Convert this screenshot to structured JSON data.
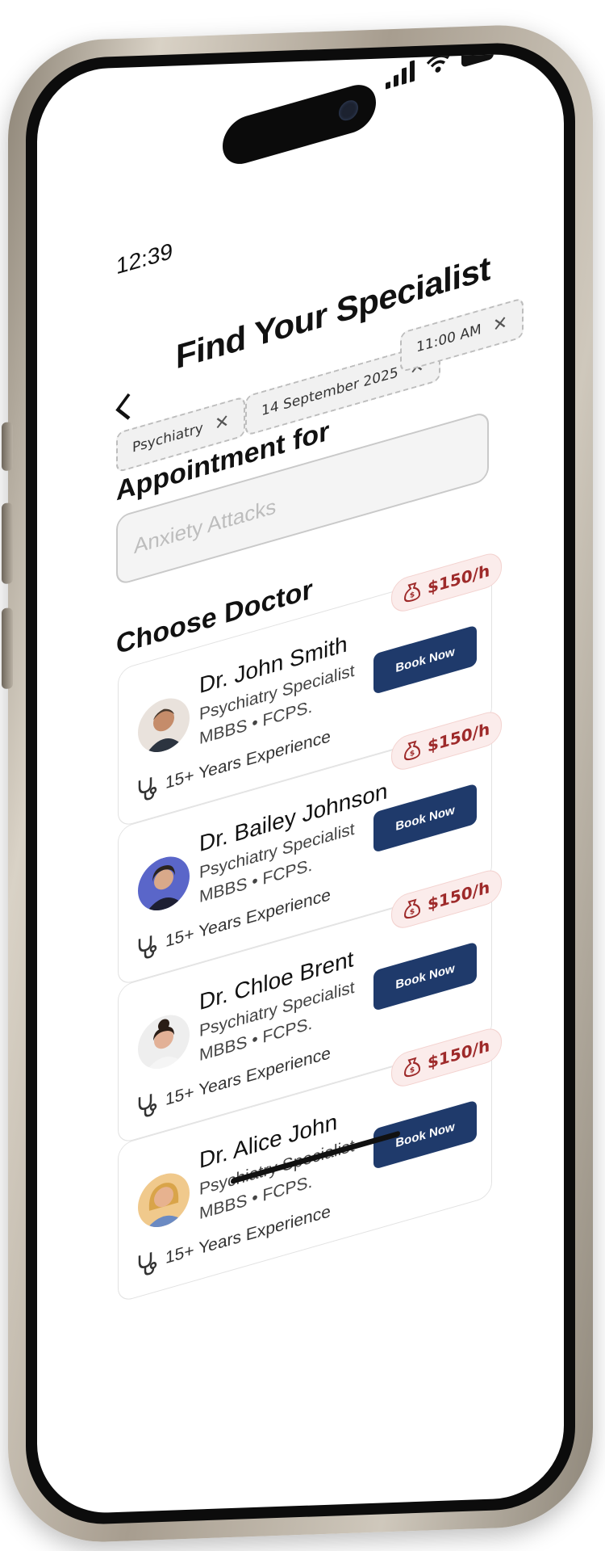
{
  "status_bar": {
    "time": "12:39"
  },
  "header": {
    "back_icon": "chevron-left-icon",
    "title": "Find Your Specialist"
  },
  "filters": [
    {
      "label": "Psychiatry"
    },
    {
      "label": "14 September 2025"
    },
    {
      "label": "11:00 AM"
    }
  ],
  "appointment": {
    "label": "Appointment for",
    "placeholder": "Anxiety Attacks"
  },
  "choose_label": "Choose Doctor",
  "doctors": [
    {
      "name": "Dr. John Smith",
      "specialty": "Psychiatry Specialist",
      "degrees": "MBBS • FCPS.",
      "experience": "15+ Years Experience",
      "price": "$150/h",
      "button": "Book Now",
      "avatar_color": "#c58c6a",
      "avatar_bg": "#e9e2dc"
    },
    {
      "name": "Dr. Bailey Johnson",
      "specialty": "Psychiatry Specialist",
      "degrees": "MBBS • FCPS.",
      "experience": "15+ Years Experience",
      "price": "$150/h",
      "button": "Book Now",
      "avatar_color": "#d9a98a",
      "avatar_bg": "#5a66c9"
    },
    {
      "name": "Dr. Chloe Brent",
      "specialty": "Psychiatry Specialist",
      "degrees": "MBBS • FCPS.",
      "experience": "15+ Years Experience",
      "price": "$150/h",
      "button": "Book Now",
      "avatar_color": "#e2b197",
      "avatar_bg": "#eeeeee"
    },
    {
      "name": "Dr. Alice John",
      "specialty": "Psychiatry Specialist",
      "degrees": "MBBS • FCPS.",
      "experience": "15+ Years Experience",
      "price": "$150/h",
      "button": "Book Now",
      "avatar_color": "#e7b28f",
      "avatar_bg": "#f0c98c"
    }
  ],
  "colors": {
    "primary": "#1f3a6b",
    "price_text": "#9e2a2a",
    "price_bg": "#fbeceb"
  }
}
